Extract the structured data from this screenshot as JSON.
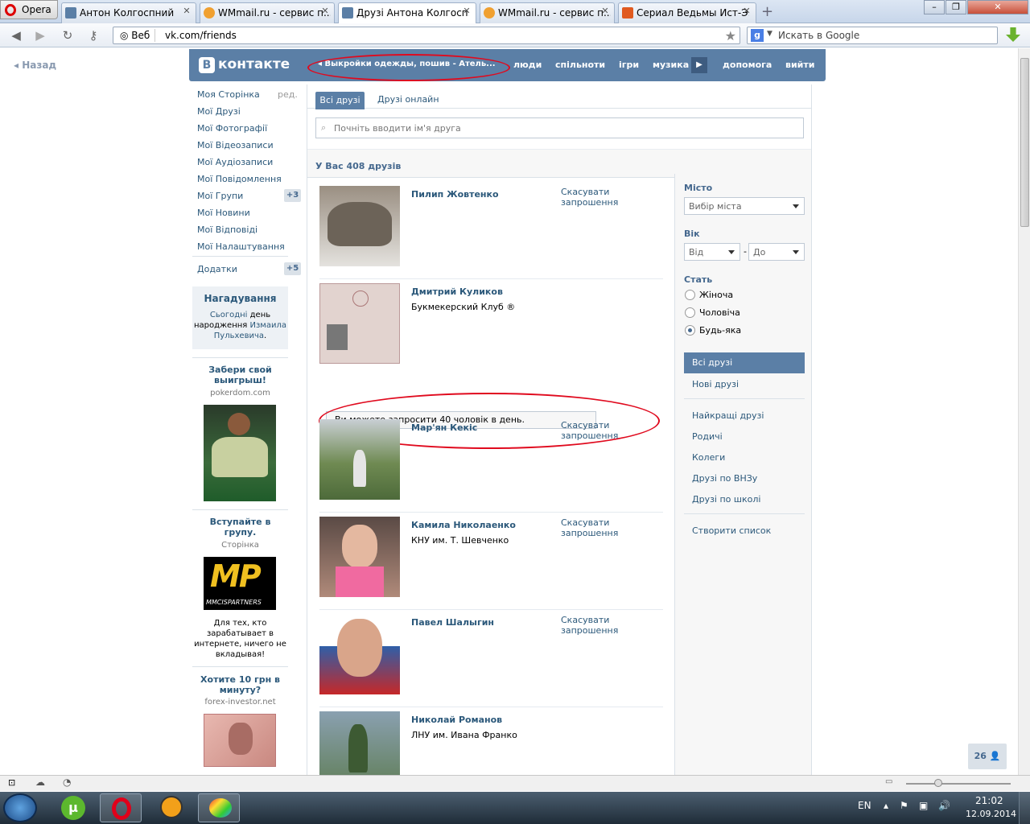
{
  "browser": {
    "menu_label": "Opera",
    "tabs": [
      {
        "title": "Антон Колгоспний",
        "fav": "#5b7fa6"
      },
      {
        "title": "WMmail.ru - сервис п...",
        "fav": "#f0a030"
      },
      {
        "title": "Друзі Антона Колгосп...",
        "fav": "#5b7fa6"
      },
      {
        "title": "WMmail.ru - сервис п...",
        "fav": "#f0a030"
      },
      {
        "title": "Сериал Ведьмы Ист-Э...",
        "fav": "#e05a20"
      }
    ],
    "addr_prefix": "Веб",
    "url": "vk.com/friends",
    "search_placeholder": "Искать в Google",
    "back_label": "Назад"
  },
  "vk": {
    "logo_text": "контакте",
    "nav": {
      "ticker": "Выкройки одежды, пошив - Атель...",
      "people": "люди",
      "communities": "спільноти",
      "games": "ігри",
      "music": "музика",
      "help": "допомога",
      "logout": "вийти"
    },
    "left_menu": [
      {
        "label": "Моя Сторінка",
        "extra": "ред."
      },
      {
        "label": "Мої Друзі"
      },
      {
        "label": "Мої Фотографії"
      },
      {
        "label": "Мої Відеозаписи"
      },
      {
        "label": "Мої Аудіозаписи"
      },
      {
        "label": "Мої Повідомлення"
      },
      {
        "label": "Мої Групи",
        "badge": "+3"
      },
      {
        "label": "Мої Новини"
      },
      {
        "label": "Мої Відповіді"
      },
      {
        "label": "Мої Налаштування"
      },
      {
        "label": "Додатки",
        "badge": "+5"
      }
    ],
    "reminder": {
      "title": "Нагадування",
      "line1_link": "Сьогодні",
      "line1_text": " день",
      "line2_text": "народження ",
      "line2_link": "Измаила",
      "line3_link": "Пульхевича",
      "line3_end": "."
    },
    "ads": [
      {
        "title": "Забери свой выигрыш!",
        "sub": "pokerdom.com"
      },
      {
        "title": "Вступайте в групу.",
        "sub": "Сторінка",
        "desc": "Для тех, кто зарабатывает в интернете, ничего не вкладывая!",
        "logo": "MP",
        "logo_sub": "MMCISPARTNERS"
      },
      {
        "title": "Хотите 10 грн в минуту?",
        "sub": "forex-investor.net"
      }
    ],
    "tabs": {
      "all": "Всі друзі",
      "online": "Друзі онлайн"
    },
    "search_placeholder": "Почніть вводити ім'я друга",
    "friends_count": "У Вас 408 друзів",
    "cancel_label": "Скасувати запрошення",
    "friends": [
      {
        "name": "Пилип Жовтенко",
        "info": "",
        "photo_bg": "#c9c6c0",
        "cancel": true
      },
      {
        "name": "Дмитрий Куликов",
        "info": "Букмекерский Клуб ®",
        "photo_bg": "#d9c3c0",
        "cancel": false
      },
      {
        "name": "Мар'ян Кекіс",
        "info": "",
        "photo_bg": "#6f8a52",
        "cancel": true
      },
      {
        "name": "Камила Николаенко",
        "info": "КНУ им. Т. Шевченко",
        "photo_bg": "#8a6b5c",
        "cancel": true
      },
      {
        "name": "Павел Шалыгин",
        "info": "",
        "photo_bg": "#3b5c8a",
        "cancel": true
      },
      {
        "name": "Николай Романов",
        "info": "ЛНУ им. Ивана Франко",
        "photo_bg": "#5f7d55",
        "cancel": false
      }
    ],
    "invite_notice": "Ви можете запросити 40 чоловік в день.",
    "filters": {
      "city_label": "Місто",
      "city_value": "Вибір міста",
      "age_label": "Вік",
      "age_from": "Від",
      "age_dash": "-",
      "age_to": "До",
      "sex_label": "Стать",
      "sex_options": [
        "Жіноча",
        "Чоловіча",
        "Будь-яка"
      ],
      "sex_selected": 2,
      "sections": [
        "Всі друзі",
        "Нові друзі"
      ],
      "categories": [
        "Найкращі друзі",
        "Родичі",
        "Колеги",
        "Друзі по ВНЗу",
        "Друзі по школі"
      ],
      "create_list": "Створити список"
    },
    "online_count": "26"
  },
  "taskbar": {
    "lang": "EN",
    "time": "21:02",
    "date": "12.09.2014"
  }
}
